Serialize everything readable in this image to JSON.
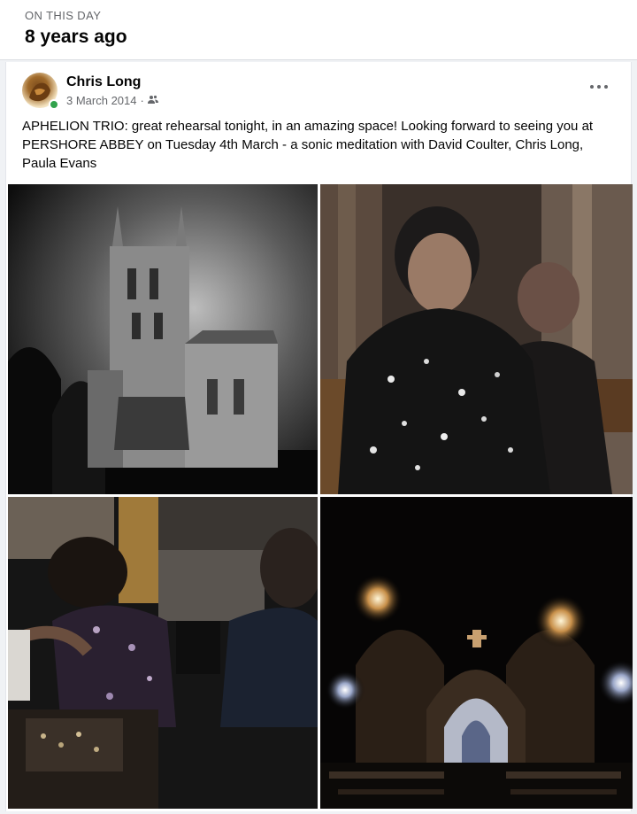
{
  "memory": {
    "kicker": "ON THIS DAY",
    "title": "8 years ago"
  },
  "post": {
    "author": "Chris Long",
    "date": "3 March 2014",
    "separator": "·",
    "audience_icon": "friends-icon",
    "more_icon": "more-options-icon",
    "online_status_color": "#31a24c",
    "text": "APHELION TRIO: great rehearsal tonight, in an amazing space! Looking forward to seeing you at PERSHORE ABBEY on Tuesday 4th March - a sonic meditation with David Coulter, Chris Long, Paula Evans"
  },
  "photos": [
    {
      "subject": "abbey-tower"
    },
    {
      "subject": "musicians-portrait"
    },
    {
      "subject": "musicians-rehearsing"
    },
    {
      "subject": "abbey-interior"
    }
  ]
}
